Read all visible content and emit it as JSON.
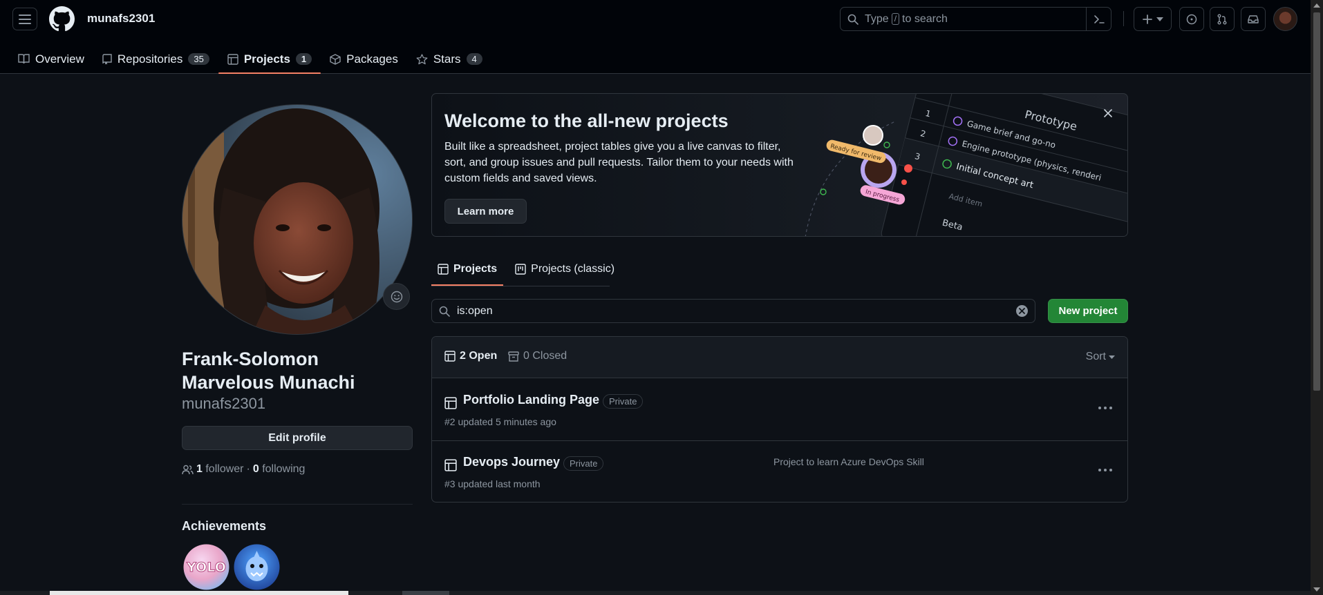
{
  "header": {
    "username": "munafs2301",
    "search_placeholder_prefix": "Type",
    "search_key": "/",
    "search_placeholder_suffix": "to search"
  },
  "nav": {
    "items": [
      {
        "label": "Overview",
        "icon": "book-icon",
        "counter": null
      },
      {
        "label": "Repositories",
        "icon": "repo-icon",
        "counter": "35"
      },
      {
        "label": "Projects",
        "icon": "table-icon",
        "counter": "1",
        "active": true
      },
      {
        "label": "Packages",
        "icon": "package-icon",
        "counter": null
      },
      {
        "label": "Stars",
        "icon": "star-icon",
        "counter": "4"
      }
    ]
  },
  "profile": {
    "full_name": "Frank-Solomon Marvelous Munachi",
    "login": "munafs2301",
    "edit_label": "Edit profile",
    "followers_count": "1",
    "followers_label": "follower",
    "separator": "·",
    "following_count": "0",
    "following_label": "following",
    "achievements_title": "Achievements",
    "badges": [
      "yolo-badge",
      "pull-shark-badge"
    ]
  },
  "banner": {
    "title": "Welcome to the all-new projects",
    "description": "Built like a spreadsheet, project tables give you a live canvas to filter, sort, and group issues and pull requests. Tailor them to your needs with custom fields and saved views.",
    "learn_more": "Learn more",
    "art": {
      "ready_tag": "Ready for review",
      "progress_tag": "In progress",
      "group_label": "Prototype",
      "rows": [
        {
          "num": "1",
          "text": "Game brief and go-no"
        },
        {
          "num": "2",
          "text": "Engine prototype (physics, renderi"
        },
        {
          "num": "3",
          "text": "Initial concept art"
        }
      ],
      "add_item": "Add item",
      "beta": "Beta"
    }
  },
  "project_tabs": [
    {
      "label": "Projects",
      "active": true
    },
    {
      "label": "Projects (classic)",
      "active": false
    }
  ],
  "filter": {
    "value": "is:open"
  },
  "new_project_label": "New project",
  "list": {
    "open_label": "2 Open",
    "closed_label": "0 Closed",
    "sort_label": "Sort",
    "projects": [
      {
        "title": "Portfolio Landing Page",
        "visibility": "Private",
        "meta": "#2 updated 5 minutes ago",
        "description": ""
      },
      {
        "title": "Devops Journey",
        "visibility": "Private",
        "meta": "#3 updated last month",
        "description": "Project to learn Azure DevOps Skill"
      }
    ]
  },
  "colors": {
    "background": "#0d1117",
    "header": "#010409",
    "accent_underline": "#f78166",
    "primary_button": "#238636",
    "border": "#30363d"
  }
}
